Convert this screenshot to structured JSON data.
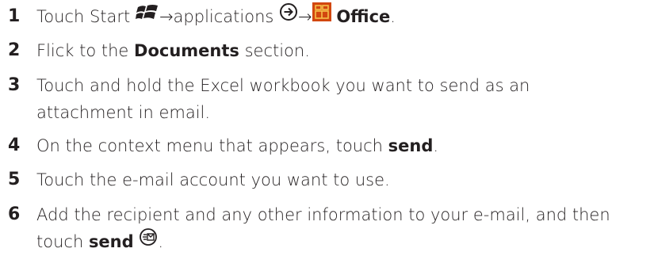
{
  "steps": [
    {
      "number": "1",
      "pre": "Touch Start ",
      "arrow1": "→",
      "mid": "applications ",
      "arrow2": "→",
      "bold": "Office",
      "post": ".",
      "icons": [
        "windows-start-icon",
        "forward-arrow-circle-icon",
        "office-hub-icon"
      ]
    },
    {
      "number": "2",
      "pre": "Flick to the ",
      "bold": "Documents",
      "post": " section."
    },
    {
      "number": "3",
      "text": "Touch and hold the Excel workbook you want to send as an attachment in email."
    },
    {
      "number": "4",
      "pre": "On the context menu that appears, touch ",
      "bold": "send",
      "post": "."
    },
    {
      "number": "5",
      "text": "Touch the e-mail account you want to use."
    },
    {
      "number": "6",
      "pre": "Add the recipient and any other information to your e-mail, and then touch ",
      "bold": "send",
      "post": ".",
      "icons": [
        "send-mail-icon"
      ]
    }
  ],
  "colors": {
    "text": "#231f20",
    "office_icon_bg": "#d2470f",
    "office_icon_fg": "#f5c04a"
  }
}
